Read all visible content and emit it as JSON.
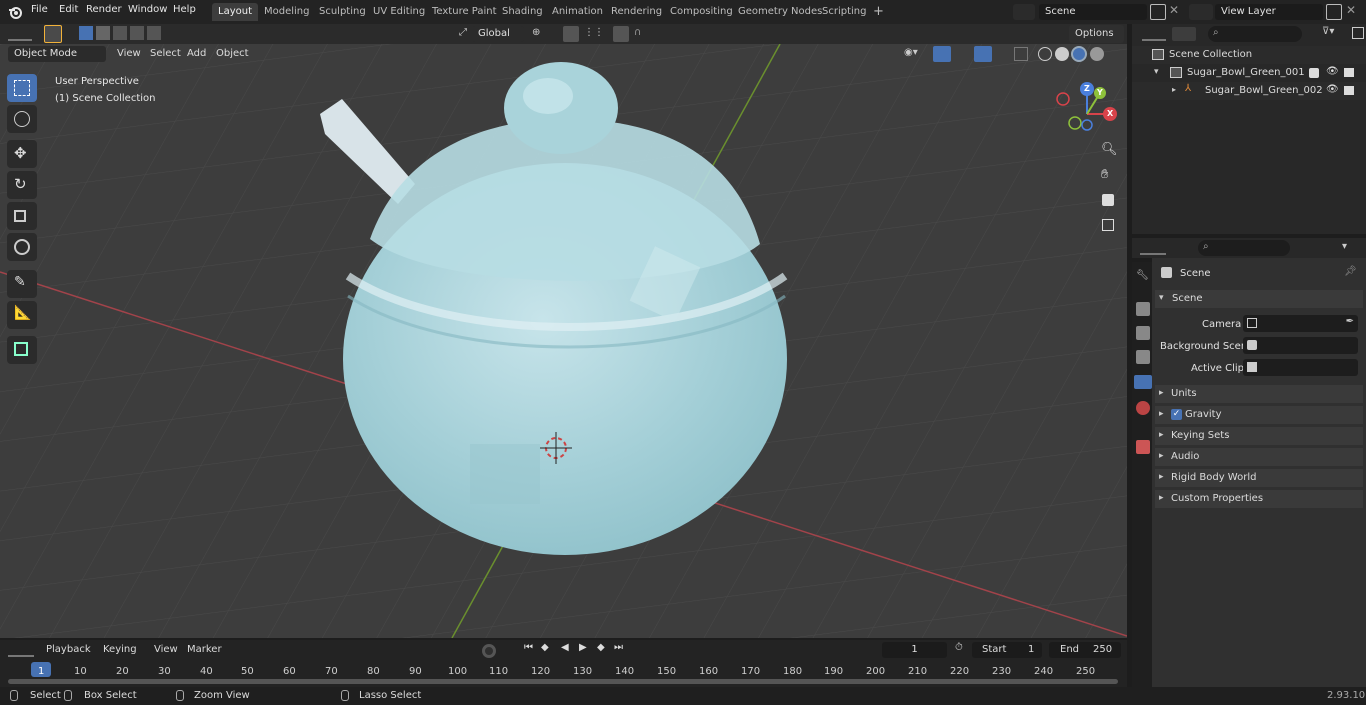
{
  "topbar": {
    "menus": [
      "File",
      "Edit",
      "Render",
      "Window",
      "Help"
    ],
    "workspaces": [
      "Layout",
      "Modeling",
      "Sculpting",
      "UV Editing",
      "Texture Paint",
      "Shading",
      "Animation",
      "Rendering",
      "Compositing",
      "Geometry Nodes",
      "Scripting"
    ],
    "active_workspace": "Layout",
    "add_tab": "+",
    "scene_name": "Scene",
    "view_layer": "View Layer"
  },
  "viewport": {
    "mode": "Object Mode",
    "header_menus": [
      "View",
      "Select",
      "Add",
      "Object"
    ],
    "transform_orientation": "Global",
    "options_label": "Options",
    "overlay_title": "User Perspective",
    "overlay_subtitle": "(1) Scene Collection",
    "gizmo_axes": {
      "x": "X",
      "y": "Y",
      "z": "Z"
    }
  },
  "outliner": {
    "root": "Scene Collection",
    "items": [
      {
        "label": "Sugar_Bowl_Green_001"
      },
      {
        "label": "Sugar_Bowl_Green_002"
      }
    ]
  },
  "properties": {
    "breadcrumb": "Scene",
    "section_title": "Scene",
    "fields": [
      {
        "label": "Camera"
      },
      {
        "label": "Background Scene"
      },
      {
        "label": "Active Clip"
      }
    ],
    "panels": [
      "Units",
      "Gravity",
      "Keying Sets",
      "Audio",
      "Rigid Body World",
      "Custom Properties"
    ]
  },
  "timeline": {
    "menus": [
      "Playback",
      "Keying",
      "View",
      "Marker"
    ],
    "current_frame": "1",
    "start_label": "Start",
    "start_value": "1",
    "end_label": "End",
    "end_value": "250",
    "ruler": [
      "1",
      "10",
      "20",
      "30",
      "40",
      "50",
      "60",
      "70",
      "80",
      "90",
      "100",
      "110",
      "120",
      "130",
      "140",
      "150",
      "160",
      "170",
      "180",
      "190",
      "200",
      "210",
      "220",
      "230",
      "240",
      "250"
    ]
  },
  "statusbar": {
    "select": "Select",
    "box_select": "Box Select",
    "zoom_view": "Zoom View",
    "lasso_select": "Lasso Select",
    "version": "2.93.10"
  },
  "colors": {
    "accent": "#4772b3",
    "x_axis": "#d8434a",
    "y_axis": "#8ec13b",
    "z_axis": "#4a7fdc",
    "object": "#a7d3da"
  }
}
